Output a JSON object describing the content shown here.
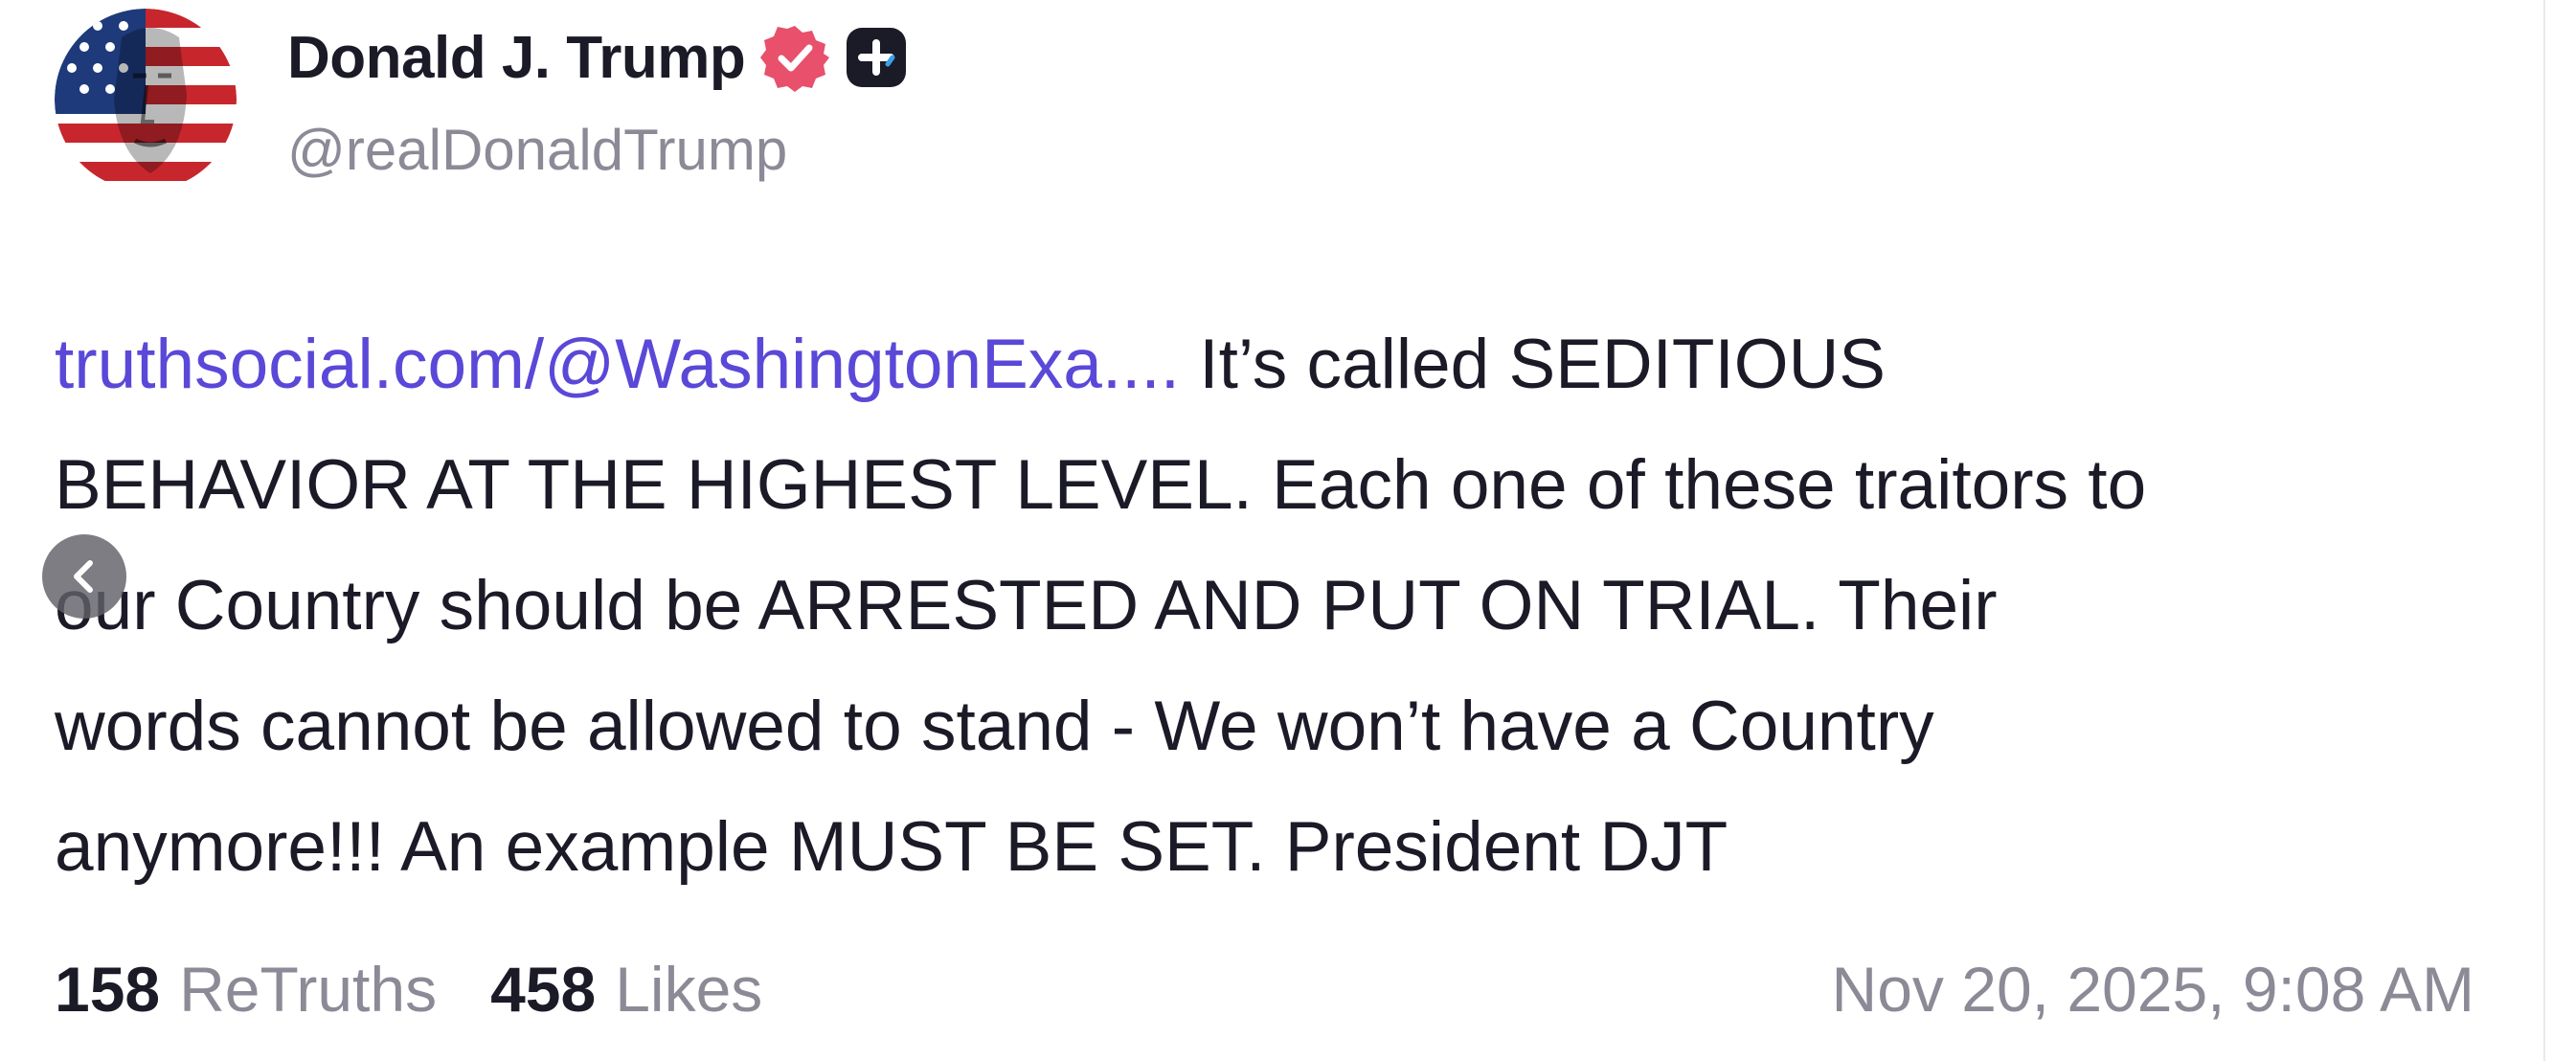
{
  "author": {
    "display_name": "Donald J. Trump",
    "handle": "@realDonaldTrump",
    "avatar_icon": "flag-portrait-avatar",
    "verified_icon": "verified-badge-icon",
    "plus_icon": "plus-badge-icon"
  },
  "post": {
    "link_text": "truthsocial.com/@WashingtonExa....",
    "text_line_1": "  It’s called SEDITIOUS",
    "text_line_2": "BEHAVIOR AT THE HIGHEST LEVEL. Each one of these traitors to",
    "text_line_3": "our Country should be ARRESTED AND PUT ON TRIAL. Their",
    "text_line_4": "words cannot be allowed to stand - We won’t have a Country",
    "text_line_5": "anymore!!! An example MUST BE SET. President DJT"
  },
  "stats": {
    "retruths_count": "158",
    "retruths_label": "ReTruths",
    "likes_count": "458",
    "likes_label": "Likes"
  },
  "timestamp": "Nov 20, 2025, 9:08 AM",
  "navigation": {
    "back_icon": "chevron-left-icon"
  },
  "colors": {
    "text": "#1b1a27",
    "muted": "#8b8a96",
    "link": "#5a48d8",
    "verified_badge": "#e8506b",
    "back_button_bg": "#606068"
  }
}
